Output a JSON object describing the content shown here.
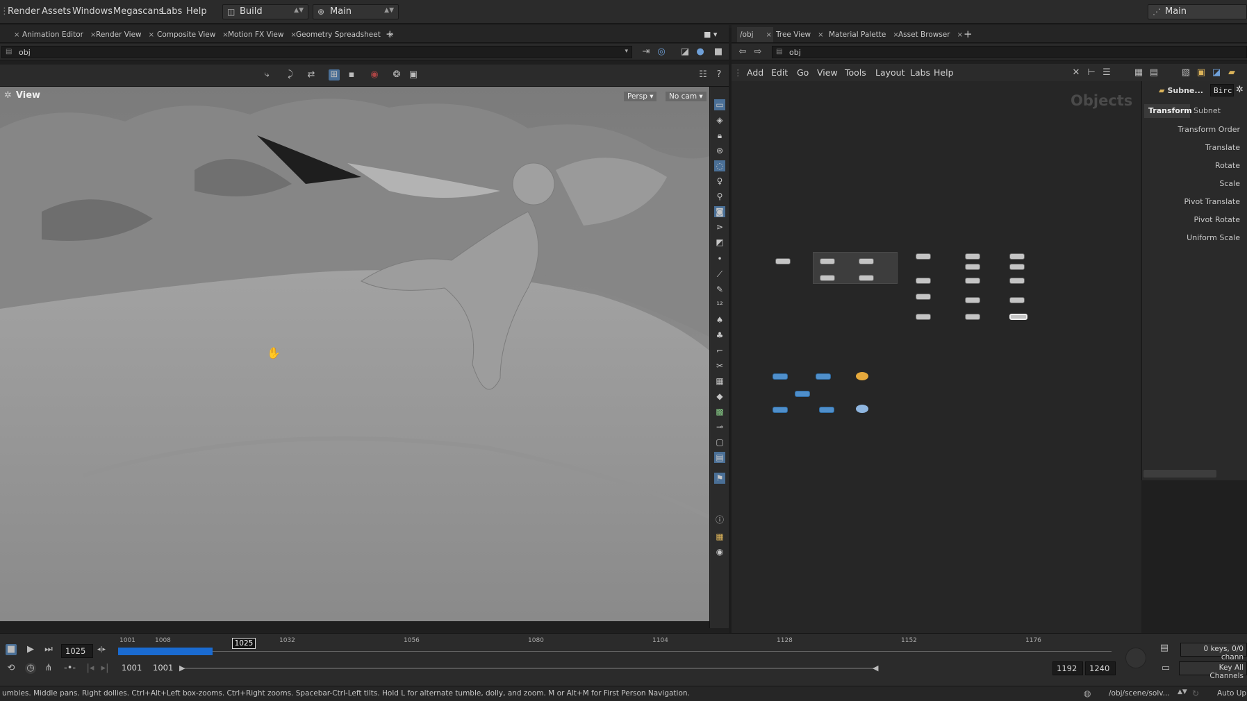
{
  "menubar": {
    "items": [
      "Render",
      "Assets",
      "Windows",
      "Megascans",
      "Labs",
      "Help"
    ],
    "desktop_label": "Build",
    "main_label": "Main",
    "right_label": "Main"
  },
  "left_tabs": [
    "Animation Editor",
    "Render View",
    "Composite View",
    "Motion FX View",
    "Geometry Spreadsheet"
  ],
  "right_tabs": [
    "/obj",
    "Tree View",
    "Material Palette",
    "Asset Browser"
  ],
  "left_path": "obj",
  "right_path": "obj",
  "viewport": {
    "title": "View",
    "persp_label": "Persp",
    "cam_label": "No cam"
  },
  "network": {
    "menu": [
      "Add",
      "Edit",
      "Go",
      "View",
      "Tools",
      "Layout",
      "Labs",
      "Help"
    ],
    "context_label": "Objects"
  },
  "params": {
    "node_name": "Subne...",
    "node_field": "Birc",
    "tabs": [
      "Transform",
      "Subnet"
    ],
    "labels": [
      "Transform Order",
      "Translate",
      "Rotate",
      "Scale",
      "Pivot Translate",
      "Pivot Rotate",
      "Uniform Scale"
    ]
  },
  "timeline": {
    "current_frame": "1025",
    "marker_frame": "1025",
    "range_start": "1001",
    "range_start2": "1001",
    "range_end": "1192",
    "range_end2": "1240",
    "ticks": [
      "1001",
      "1008",
      "1032",
      "1056",
      "1080",
      "1104",
      "1128",
      "1152",
      "1176"
    ],
    "keys_label": "0 keys, 0/0 chann",
    "key_all_label": "Key All Channels"
  },
  "status": {
    "message": "umbles. Middle pans. Right dollies. Ctrl+Alt+Left box-zooms. Ctrl+Right zooms. Spacebar-Ctrl-Left tilts. Hold L for alternate tumble, dolly, and zoom. M or Alt+M for First Person Navigation.",
    "path": "/obj/scene/solv...",
    "auto_update": "Auto Up"
  },
  "colors": {
    "accent": "#1a6bd1",
    "panel": "#2b2b2b",
    "viewport": "#8d8d8d"
  }
}
